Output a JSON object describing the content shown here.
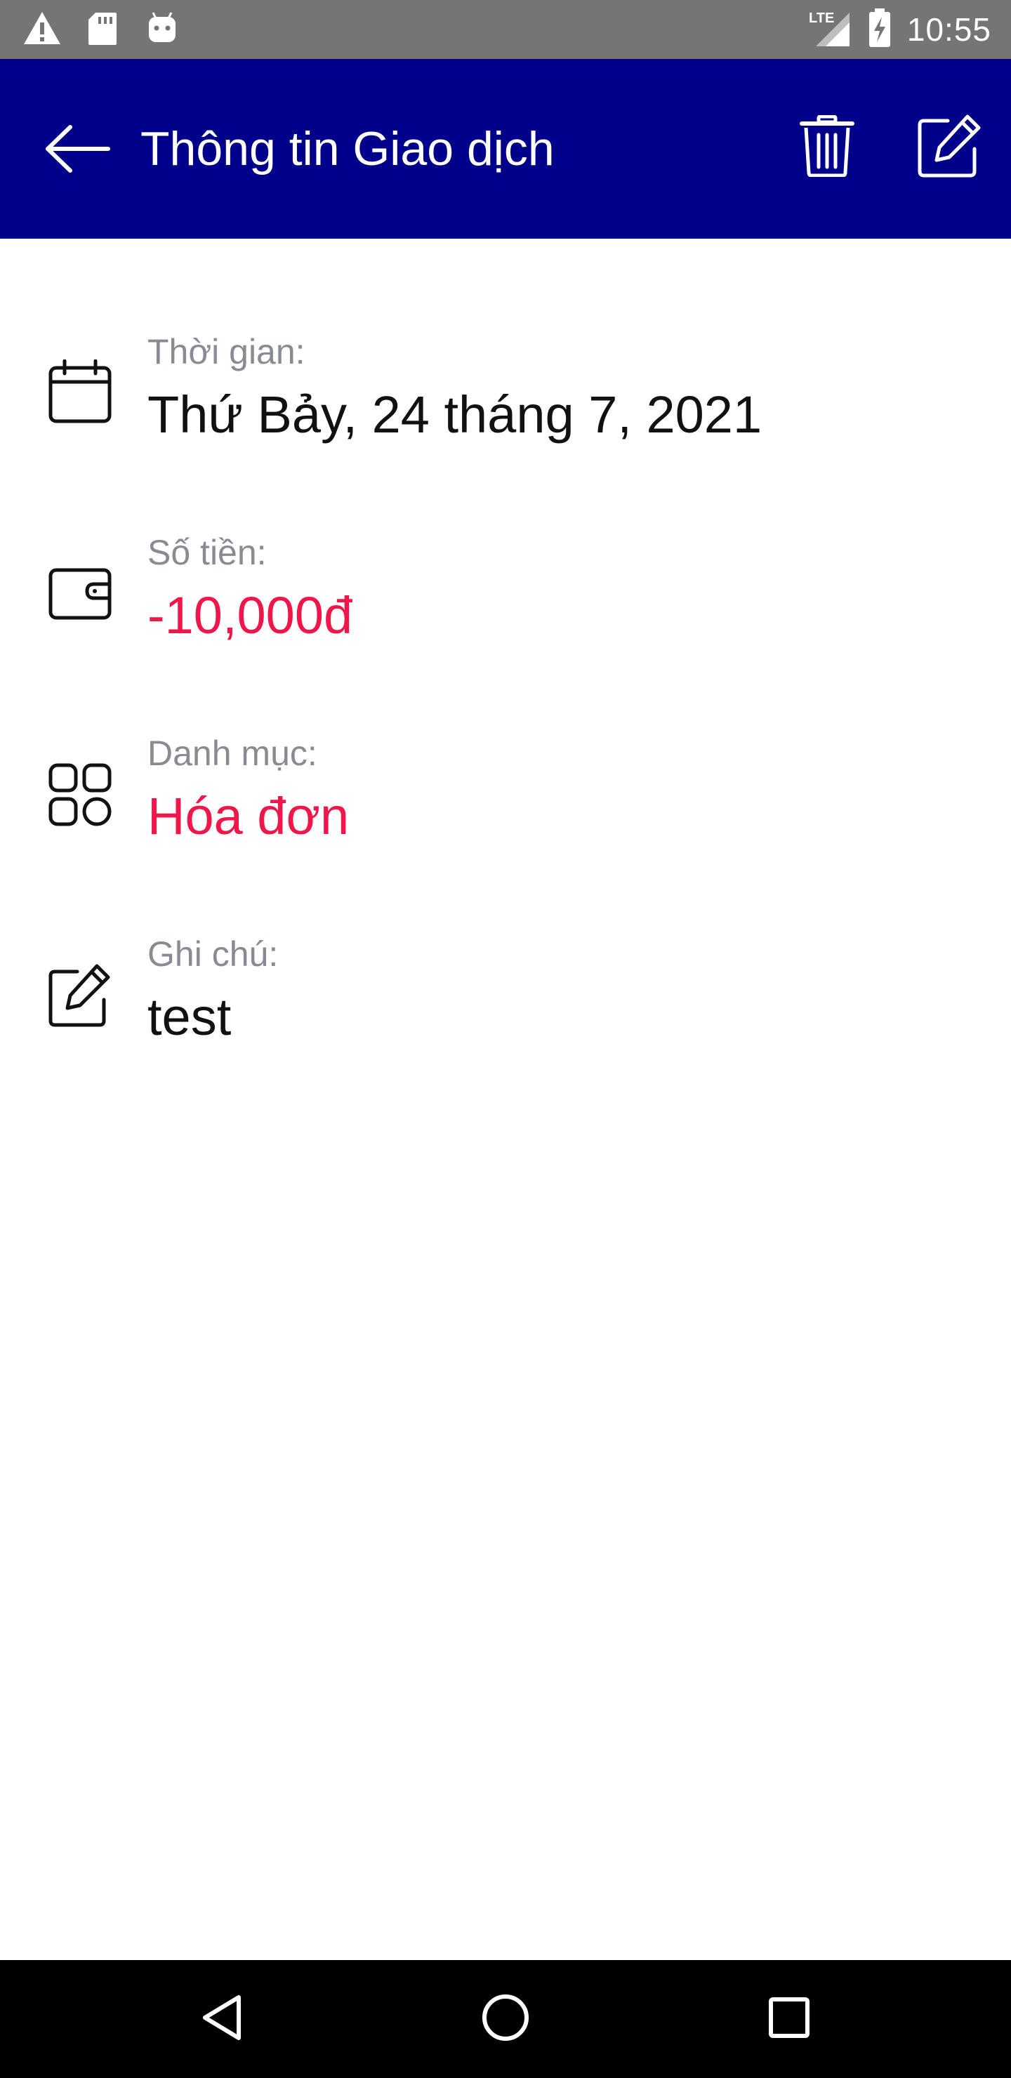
{
  "status_bar": {
    "time": "10:55",
    "network": "LTE",
    "icons": [
      "warning-icon",
      "sd-card-icon",
      "android-icon",
      "signal-icon",
      "battery-charging-icon"
    ]
  },
  "app_bar": {
    "title": "Thông tin Giao dịch",
    "back_icon": "arrow-left-icon",
    "delete_icon": "trash-icon",
    "edit_icon": "edit-icon"
  },
  "details": [
    {
      "label": "Thời gian:",
      "value": "Thứ Bảy, 24 tháng 7, 2021",
      "icon": "calendar-icon"
    },
    {
      "label": "Số tiền:",
      "value": "-10,000đ",
      "icon": "wallet-icon"
    },
    {
      "label": "Danh mục:",
      "value": "Hóa đơn",
      "icon": "category-icon"
    },
    {
      "label": "Ghi chú:",
      "value": "test",
      "icon": "note-icon"
    }
  ],
  "colors": {
    "app_bar": "#00008b",
    "status_bar": "#757575",
    "accent_red": "#f0164a",
    "label_gray": "#888b91"
  },
  "nav_bar": {
    "icons": [
      "back-triangle-icon",
      "home-circle-icon",
      "recents-square-icon"
    ]
  }
}
